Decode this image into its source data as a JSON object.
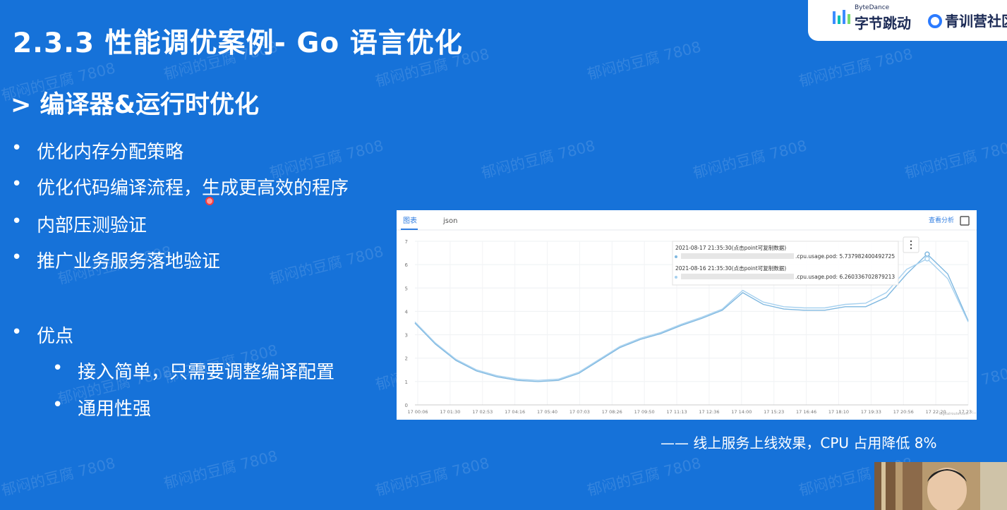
{
  "slide": {
    "title": "2.3.3 性能调优案例- Go 语言优化",
    "subtitle": "> 编译器&运行时优化",
    "bullets": [
      "优化内存分配策略",
      "优化代码编译流程，生成更高效的程序",
      "内部压测验证",
      "推广业务服务落地验证"
    ],
    "advantages_label": "优点",
    "advantages": [
      "接入简单，只需要调整编译配置",
      "通用性强"
    ],
    "caption": "—— 线上服务上线效果，CPU 占用降低 8%",
    "bullet_symbol": "•"
  },
  "branding": {
    "bytedance_small": "ByteDance",
    "bytedance_name": "字节跳动",
    "camp_name": "青训营社区"
  },
  "watermark": "郁闷的豆腐 7808",
  "chart_panel": {
    "tabs": [
      "图表",
      "json"
    ],
    "active_tab": "图表",
    "link_label": "查看分析",
    "expand_icon": "expand-icon",
    "more_icon": "more-vertical-icon",
    "footer_text": "digitalroute.com"
  },
  "chart_data": {
    "type": "line",
    "ylim": [
      0,
      7
    ],
    "yticks": [
      "0",
      "1",
      "2",
      "3",
      "4",
      "5",
      "6",
      "7"
    ],
    "x_tick_labels": [
      "17 00:06",
      "17 01:30",
      "17 02:53",
      "17 04:16",
      "17 05:40",
      "17 07:03",
      "17 08:26",
      "17 09:50",
      "17 11:13",
      "17 12:36",
      "17 14:00",
      "17 15:23",
      "17 16:46",
      "17 18:10",
      "17 19:33",
      "17 20:56",
      "17 22:20",
      "17 23:..."
    ],
    "series": [
      {
        "name": "cpu.usage.pod",
        "color": "#7fb8e0",
        "values": [
          3.5,
          2.6,
          1.9,
          1.45,
          1.2,
          1.05,
          1.0,
          1.05,
          1.35,
          1.9,
          2.45,
          2.8,
          3.05,
          3.4,
          3.7,
          4.05,
          4.8,
          4.3,
          4.1,
          4.05,
          4.05,
          4.2,
          4.2,
          4.6,
          5.6,
          6.45,
          5.6,
          3.6
        ]
      },
      {
        "name": "cpu.usage.pod",
        "color": "#a7d1ef",
        "values": [
          3.55,
          2.65,
          1.95,
          1.5,
          1.25,
          1.1,
          1.05,
          1.1,
          1.4,
          1.95,
          2.5,
          2.85,
          3.1,
          3.45,
          3.75,
          4.1,
          4.9,
          4.4,
          4.2,
          4.15,
          4.15,
          4.3,
          4.35,
          4.8,
          5.8,
          6.25,
          5.4,
          3.55
        ]
      }
    ],
    "tooltip": [
      {
        "time": "2021-08-17 21:35:30(点击point可复制数据)",
        "metric": ".cpu.usage.pod: 5.737982400492725"
      },
      {
        "time": "2021-08-16 21:35:30(点击point可复制数据)",
        "metric": ".cpu.usage.pod: 6.260336702879213"
      }
    ],
    "grid": true,
    "legend": "none"
  },
  "webcam": {
    "icon": "person-video-icon"
  }
}
